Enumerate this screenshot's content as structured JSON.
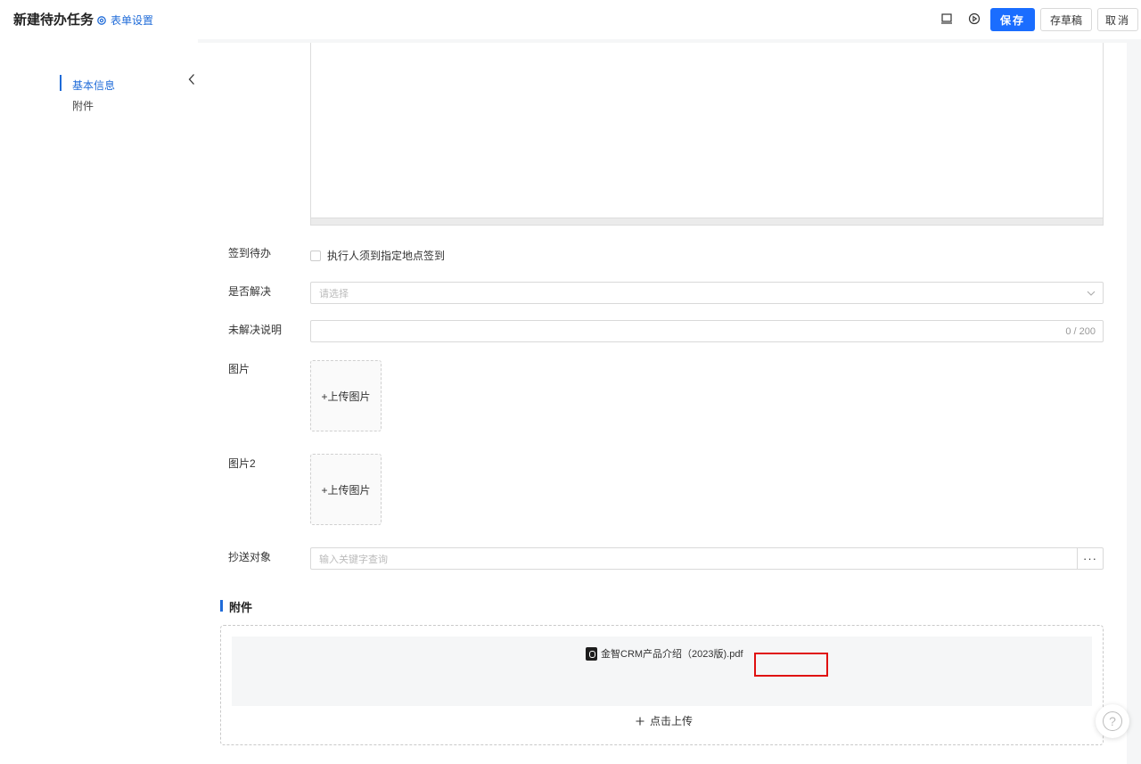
{
  "header": {
    "title": "新建待办任务",
    "form_settings": "表单设置",
    "save": "保存",
    "save_draft": "存草稿",
    "cancel": "取消"
  },
  "sidebar": {
    "items": [
      {
        "label": "基本信息",
        "active": true
      },
      {
        "label": "附件",
        "active": false
      }
    ]
  },
  "form": {
    "checkin_label": "签到待办",
    "checkin_option": "执行人须到指定地点签到",
    "resolved_label": "是否解决",
    "resolved_placeholder": "请选择",
    "unresolved_label": "未解决说明",
    "unresolved_counter": "0 / 200",
    "image_label": "图片",
    "image_upload": "+上传图片",
    "image2_label": "图片2",
    "image2_upload": "+上传图片",
    "cc_label": "抄送对象",
    "cc_placeholder": "输入关键字查询",
    "cc_more": "···"
  },
  "attachments": {
    "title": "附件",
    "files": [
      {
        "name": "金智CRM产品介绍（2023版).pdf"
      }
    ],
    "upload_label": "点击上传"
  },
  "colors": {
    "primary": "#1a6dff",
    "link": "#1f6bd8",
    "highlight": "#e01010"
  }
}
